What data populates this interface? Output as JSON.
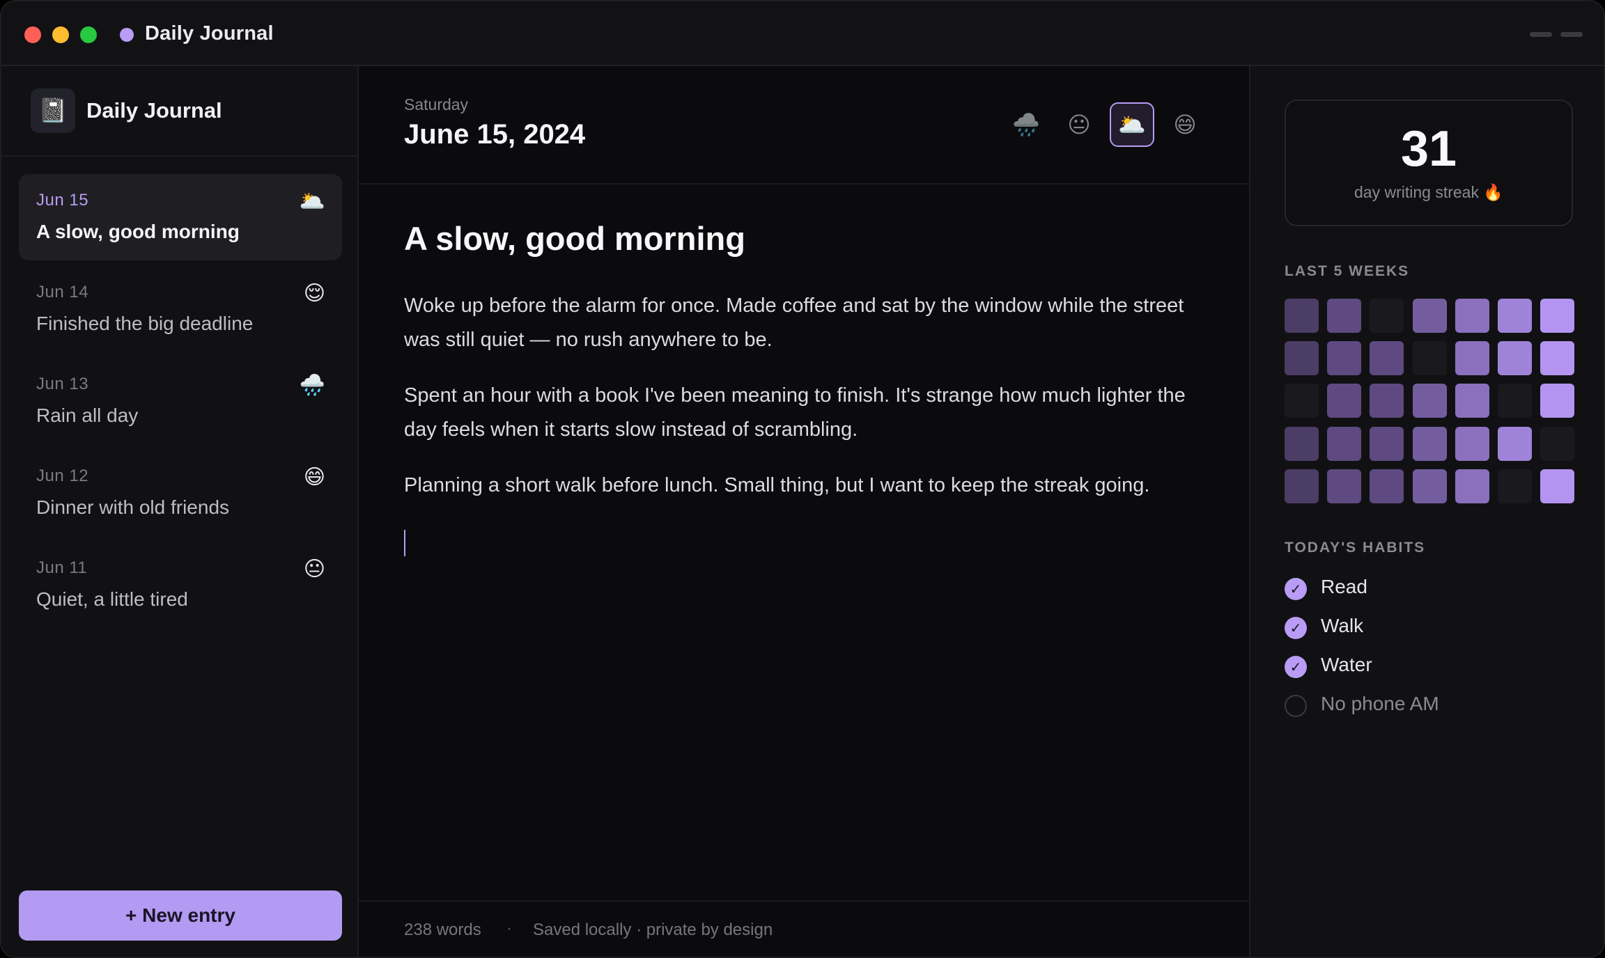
{
  "window": {
    "title": "Daily Journal"
  },
  "sidebar": {
    "title": "Daily Journal",
    "icon": "📓",
    "entries": [
      {
        "date": "Jun 15",
        "title": "A slow, good morning",
        "mood": "🌥️",
        "active": true
      },
      {
        "date": "Jun 14",
        "title": "Finished the big deadline",
        "mood": "😌"
      },
      {
        "date": "Jun 13",
        "title": "Rain all day",
        "mood": "🌧️"
      },
      {
        "date": "Jun 12",
        "title": "Dinner with old friends",
        "mood": "😄"
      },
      {
        "date": "Jun 11",
        "title": "Quiet, a little tired",
        "mood": "😐"
      }
    ],
    "new_entry_label": "+ New entry"
  },
  "main": {
    "weekday": "Saturday",
    "date": "June 15, 2024",
    "moods": [
      "🌧️",
      "😐",
      "🌥️",
      "😄"
    ],
    "selected_mood_index": 2,
    "heading": "A slow, good morning",
    "paragraphs": [
      "Woke up before the alarm for once. Made coffee and sat by the window while the street was still quiet — no rush anywhere to be.",
      "Spent an hour with a book I've been meaning to finish. It's strange how much lighter the day feels when it starts slow instead of scrambling.",
      "Planning a short walk before lunch. Small thing, but I want to keep the streak going."
    ],
    "word_count": "238 words",
    "separator": "·",
    "saved_status": "Saved locally · private by design"
  },
  "right": {
    "streak_number": "31",
    "streak_label": "day writing streak 🔥",
    "weeks_label": "LAST 5 WEEKS",
    "weeks_grid": [
      [
        1,
        2,
        0,
        3,
        4,
        5,
        6
      ],
      [
        1,
        2,
        2,
        0,
        4,
        5,
        6
      ],
      [
        0,
        2,
        2,
        3,
        4,
        0,
        6
      ],
      [
        1,
        2,
        2,
        3,
        4,
        5,
        0
      ],
      [
        1,
        2,
        2,
        3,
        4,
        0,
        6
      ]
    ],
    "level_colors": [
      "#1a1a1e",
      "#4b3d66",
      "#5e4a80",
      "#735d9e",
      "#8a70bd",
      "#9f83d9",
      "#b394f0"
    ],
    "habits_label": "TODAY'S HABITS",
    "habits": [
      {
        "label": "Read",
        "done": true
      },
      {
        "label": "Walk",
        "done": true
      },
      {
        "label": "Water",
        "done": true
      },
      {
        "label": "No phone AM",
        "done": false
      }
    ],
    "check_glyph": "✓"
  }
}
